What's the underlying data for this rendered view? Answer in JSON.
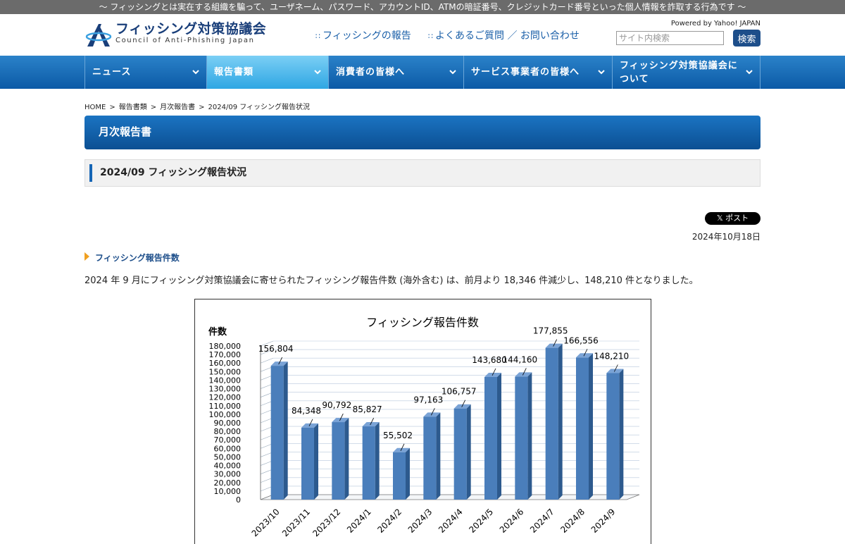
{
  "topbar": {
    "text": "〜 フィッシングとは実在する組織を騙って、ユーザネーム、パスワード、アカウントID、ATMの暗証番号、クレジットカード番号といった個人情報を詐取する行為です 〜"
  },
  "header": {
    "logo_title": "フィッシング対策協議会",
    "logo_sub": "Council of Anti-Phishing Japan",
    "link_report": "フィッシングの報告",
    "link_faq": "よくあるご質問 ／ お問い合わせ",
    "powered": "Powered by Yahoo! JAPAN",
    "search_placeholder": "サイト内検索",
    "search_button": "検索"
  },
  "nav": {
    "items": [
      {
        "label": "ニュース"
      },
      {
        "label": "報告書類"
      },
      {
        "label": "消費者の皆様へ"
      },
      {
        "label": "サービス事業者の皆様へ"
      },
      {
        "label": "フィッシング対策協議会について"
      }
    ]
  },
  "breadcrumb": {
    "home": "HOME",
    "reports": "報告書類",
    "monthly": "月次報告書",
    "current": "2024/09 フィッシング報告状況"
  },
  "page": {
    "banner": "月次報告書",
    "subhead": "2024/09 フィッシング報告状況",
    "post_button": "ポスト",
    "date": "2024年10月18日",
    "section_title": "フィッシング報告件数",
    "body": "2024 年 9 月にフィッシング対策協議会に寄せられたフィッシング報告件数 (海外含む) は、前月より 18,346 件減少し、148,210 件となりました。"
  },
  "chart_data": {
    "type": "bar",
    "title": "フィッシング報告件数",
    "ylabel": "件数",
    "xlabel": "",
    "categories": [
      "2023/10",
      "2023/11",
      "2023/12",
      "2024/1",
      "2024/2",
      "2024/3",
      "2024/4",
      "2024/5",
      "2024/6",
      "2024/7",
      "2024/8",
      "2024/9"
    ],
    "values": [
      156804,
      84348,
      90792,
      85827,
      55502,
      97163,
      106757,
      143680,
      144160,
      177855,
      166556,
      148210
    ],
    "value_labels": [
      "156,804",
      "84,348",
      "90,792",
      "85,827",
      "55,502",
      "97,163",
      "106,757",
      "143,680",
      "144,160",
      "177,855",
      "166,556",
      "148,210"
    ],
    "ylim": [
      0,
      180000
    ],
    "ytick_step": 10000,
    "grid": true,
    "bar_color": "#4a7ebb"
  }
}
